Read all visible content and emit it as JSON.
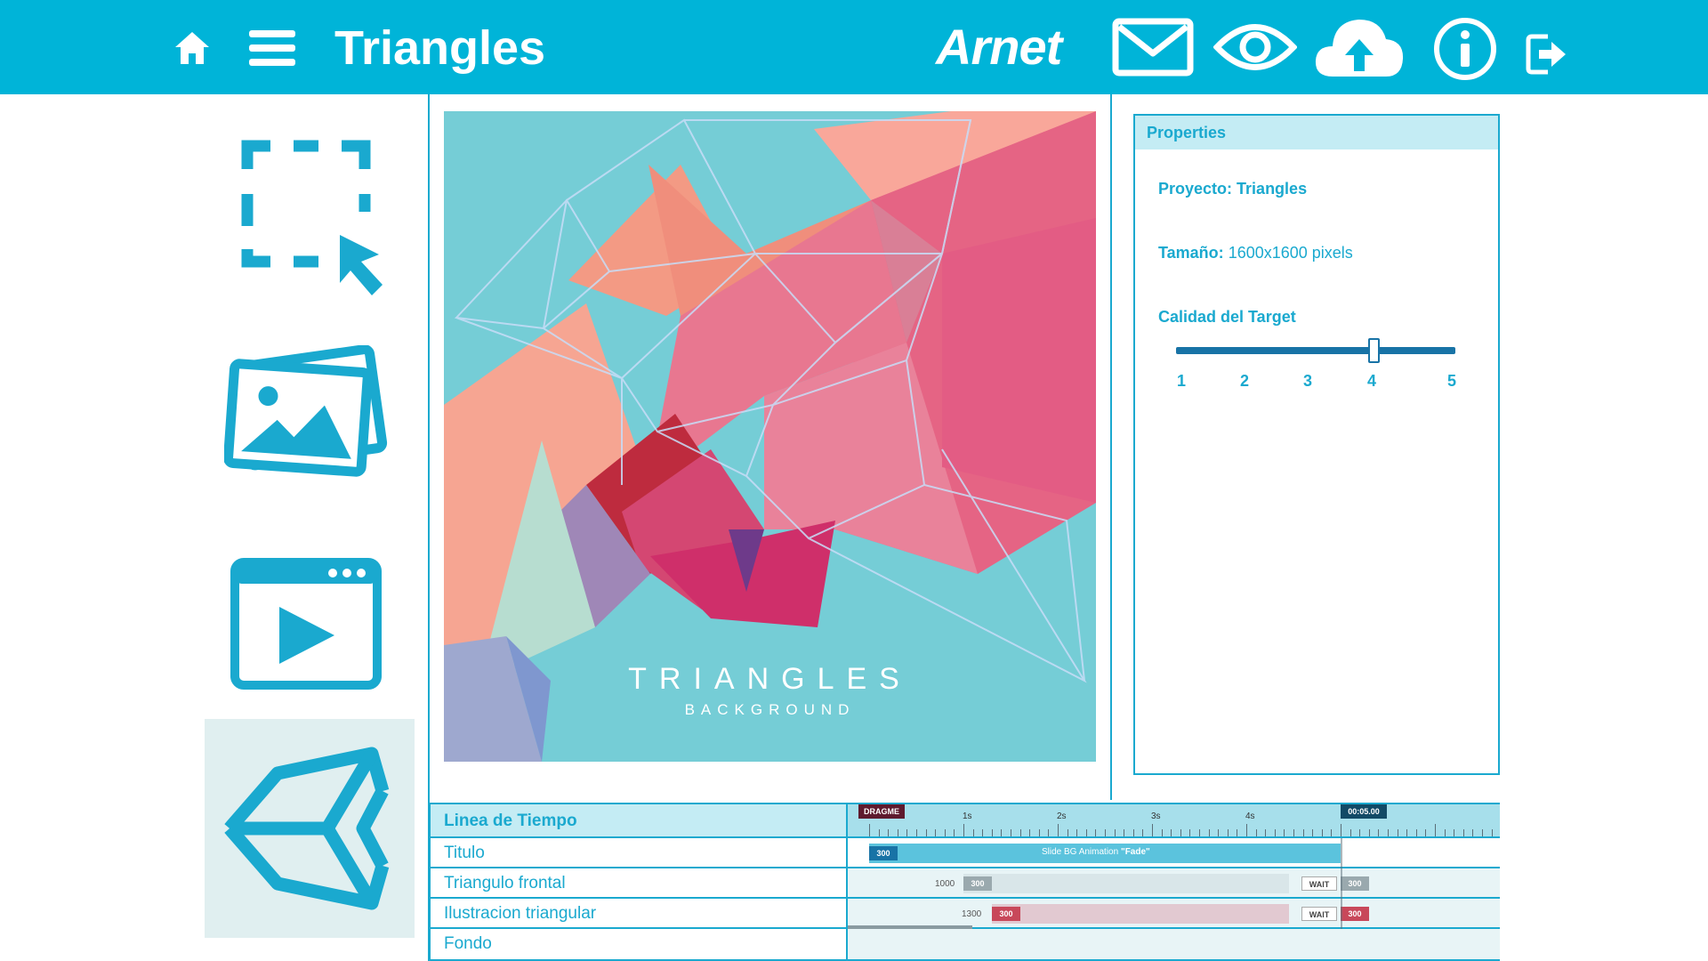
{
  "app": {
    "title": "Triangles",
    "brand": "Arnet"
  },
  "topbar": {
    "icons": [
      "home-icon",
      "menu-icon",
      "mail-icon",
      "eye-icon",
      "cloud-upload-icon",
      "info-icon",
      "logout-icon"
    ]
  },
  "sidebar": {
    "tools": [
      "selection-icon",
      "images-icon",
      "video-player-icon",
      "unity-icon"
    ],
    "active_tool": "unity-icon"
  },
  "canvas": {
    "title": "TRIANGLES",
    "subtitle": "BACKGROUND"
  },
  "properties": {
    "header": "Properties",
    "project_label": "Proyecto:",
    "project_value": "Triangles",
    "size_label": "Tamaño:",
    "size_value": "1600x1600 pixels",
    "quality_label": "Calidad del Target",
    "quality_ticks": [
      "1",
      "2",
      "3",
      "4",
      "5"
    ],
    "quality_value": 4
  },
  "timeline": {
    "header": "Linea de Tiempo",
    "layers": [
      "Titulo",
      "Triangulo frontal",
      "Ilustracion triangular",
      "Fondo"
    ],
    "marker_start": "DRAGME",
    "marker_end": "00:05.00",
    "seconds": [
      "1s",
      "2s",
      "3s",
      "4s"
    ],
    "clips": {
      "titulo_duration": "300",
      "titulo_animation": "Slide BG Animation",
      "titulo_effect": "\"Fade\"",
      "frontal_delay": "1000",
      "frontal_in": "300",
      "frontal_wait": "WAIT",
      "frontal_out": "300",
      "ilustracion_delay": "1300",
      "ilustracion_in": "300",
      "ilustracion_wait": "WAIT",
      "ilustracion_out": "300"
    }
  },
  "colors": {
    "accent": "#00b4d8",
    "text_accent": "#1aa9cf",
    "panel_header": "#c4ecf4",
    "slider": "#1873a6"
  }
}
